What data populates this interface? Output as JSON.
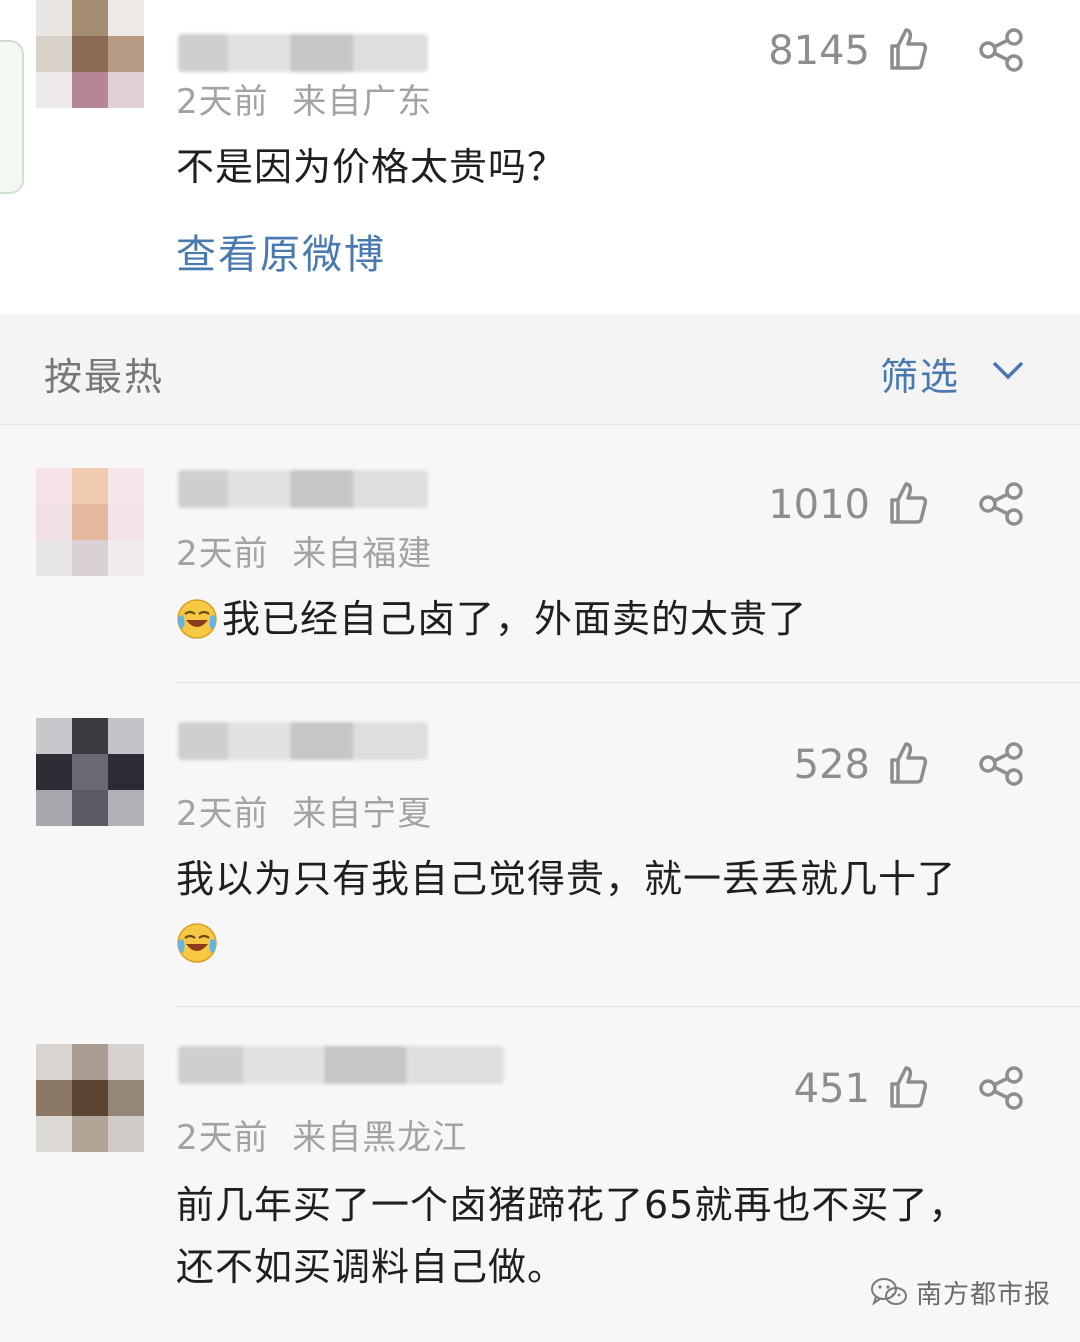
{
  "original_post": {
    "likes": "8145",
    "time": "2天前",
    "location": "来自广东",
    "text": "不是因为价格太贵吗？",
    "view_original_label": "查看原微博"
  },
  "sort_bar": {
    "sort_label": "按最热",
    "filter_label": "筛选"
  },
  "comments": [
    {
      "likes": "1010",
      "time": "2天前",
      "location": "来自福建",
      "emoji": "laugh-cry-emoji",
      "text": "我已经自己卤了，外面卖的太贵了"
    },
    {
      "likes": "528",
      "time": "2天前",
      "location": "来自宁夏",
      "text_line1": "我以为只有我自己觉得贵，就一丢丢就几十了",
      "emoji": "laugh-cry-emoji"
    },
    {
      "likes": "451",
      "time": "2天前",
      "location": "来自黑龙江",
      "text_line1": "前几年买了一个卤猪蹄花了65就再也不买了，",
      "text_line2": "还不如买调料自己做。"
    }
  ],
  "watermark": {
    "text": "南方都市报",
    "icon": "wechat-icon"
  },
  "colors": {
    "link": "#4a79b0",
    "meta": "#a3a3a3",
    "like": "#8d8d8d"
  }
}
